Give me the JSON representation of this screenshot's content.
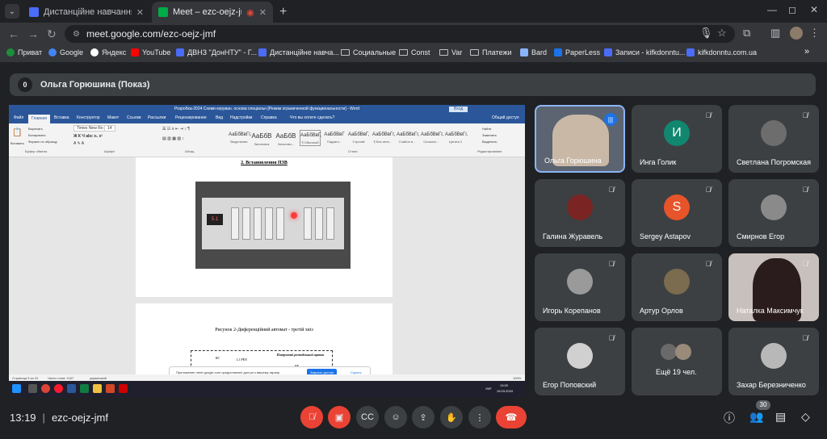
{
  "browser": {
    "tabs": [
      {
        "title": "Дистанційне навчання в ВСП ",
        "active": false
      },
      {
        "title": "Meet – ezc-oejz-jmf",
        "active": true
      }
    ],
    "new_tab": "+",
    "url": "meet.google.com/ezc-oejz-jmf",
    "window_controls": {
      "minimize": "—",
      "maximize": "◻",
      "close": "✕"
    }
  },
  "bookmarks": [
    {
      "label": "Приват",
      "color": "#1b8f3c",
      "icon": "privat-icon"
    },
    {
      "label": "Google",
      "color": "#4285f4",
      "icon": "google-icon"
    },
    {
      "label": "Яндекс",
      "color": "#ffffff",
      "icon": "yandex-icon"
    },
    {
      "label": "YouTube",
      "color": "#ff0000",
      "icon": "youtube-icon"
    },
    {
      "label": "ДВНЗ \"ДонНТУ\" - Г...",
      "color": "#4a6cf7",
      "icon": "site-icon"
    },
    {
      "label": "Дистанційне навча...",
      "color": "#4a6cf7",
      "icon": "site-icon"
    },
    {
      "label": "Социальные",
      "color": "",
      "icon": "folder-icon"
    },
    {
      "label": "Const",
      "color": "",
      "icon": "folder-icon"
    },
    {
      "label": "Var",
      "color": "",
      "icon": "folder-icon"
    },
    {
      "label": "Платежи",
      "color": "",
      "icon": "folder-icon"
    },
    {
      "label": "Bard",
      "color": "#8ab4f8",
      "icon": "bard-icon"
    },
    {
      "label": "PaperLess",
      "color": "#1a73e8",
      "icon": "paperless-icon"
    },
    {
      "label": "Записи - kifkdonntu...",
      "color": "#4a6cf7",
      "icon": "site-icon"
    },
    {
      "label": "kifkdonntu.com.ua",
      "color": "#4a6cf7",
      "icon": "site-icon"
    }
  ],
  "bookmarks_more": "»",
  "presenter": {
    "badge": "0",
    "label": "Ольга Горюшина (Показ)"
  },
  "shared_screen": {
    "window_title": "Розробка-2024 Схеми керуван. основа спеціальн [Режим ограниченной функциональности] - Word",
    "login_button": "Вход",
    "ribbon_tabs": [
      "Файл",
      "Главная",
      "Вставка",
      "Конструктор",
      "Макет",
      "Ссылки",
      "Рассылки",
      "Рецензирование",
      "Вид",
      "Надстройки",
      "Справка",
      "Что вы хотите сделать?"
    ],
    "share_label": "Общий доступ",
    "groups": [
      "Буфер обмена",
      "Шрифт",
      "Абзац",
      "Стили",
      "Редактирование"
    ],
    "font_name": "Times New Ro",
    "font_size": "14",
    "paste_label": "Вставить",
    "clipboard_items": [
      "Вырезать",
      "Копировать",
      "Формат по образцу"
    ],
    "editing_items": [
      "Найти",
      "Заменить",
      "Выделить"
    ],
    "styles": [
      {
        "sample": "АаБбВвГг,",
        "name": "Выделение"
      },
      {
        "sample": "АаБбВ",
        "name": "Заголовок"
      },
      {
        "sample": "АаБбВ",
        "name": "Заголово..."
      },
      {
        "sample": "АаБбВвГ,",
        "name": "¶ Обычный"
      },
      {
        "sample": "АаБбВвГ",
        "name": "Подзаго..."
      },
      {
        "sample": "АаБбВвГ,",
        "name": "Строгий"
      },
      {
        "sample": "АаБбВвГг,",
        "name": "¶ Без инте..."
      },
      {
        "sample": "АаБбВвГг,",
        "name": "Слабое в..."
      },
      {
        "sample": "АаБбВвГг,",
        "name": "Сильнох..."
      },
      {
        "sample": "АаБбВвГг,",
        "name": "Цитата 2"
      }
    ],
    "section_title": "2. Встановлення ПЗВ",
    "figure_caption": "Рисунок 2-Диференційний автомат - третій хвіз",
    "display_value": "5.1",
    "schematic": {
      "heading": "Поверховий розподільний щиток",
      "label_rc": "RC",
      "label_pen": "L1 PEN",
      "label_pe": "PE"
    },
    "status_left": "Страница 5 из 24",
    "status_words": "Число слов: 1167",
    "status_lang": "украинский",
    "status_zoom": "100%",
    "notification": "Приложение meet.google.com предоставлен доступ к вашему экрану.",
    "notification_button": "Закрыть доступ",
    "notification_link": "Скрыть",
    "taskbar_lang": "УКР",
    "taskbar_time": "13:20",
    "taskbar_date": "19.03.2024"
  },
  "participants": [
    {
      "name": "Ольга Горюшина",
      "type": "video",
      "speaking": true
    },
    {
      "name": "Инга Голик",
      "type": "initial",
      "initial": "И",
      "color": "#12876f"
    },
    {
      "name": "Светлана Погромская",
      "type": "photo",
      "color": "#6d6d6d"
    },
    {
      "name": "Галина Журавель",
      "type": "photo",
      "color": "#7a2424"
    },
    {
      "name": "Sergey Astapov",
      "type": "initial",
      "initial": "S",
      "color": "#e8542a"
    },
    {
      "name": "Смирнов Егор",
      "type": "photo",
      "color": "#8a8a8a"
    },
    {
      "name": "Игорь Корепанов",
      "type": "photo",
      "color": "#9a9a9a"
    },
    {
      "name": "Артур Орлов",
      "type": "photo",
      "color": "#7b6b4f"
    },
    {
      "name": "Наталка Максимчук",
      "type": "video",
      "color": "#3a2a2a"
    },
    {
      "name": "Егор Поповский",
      "type": "photo",
      "color": "#d0d0d0"
    },
    {
      "name": "Ещё 19 чел.",
      "type": "group",
      "color": "#6a6a6a"
    },
    {
      "name": "Захар Березниченко",
      "type": "photo",
      "color": "#b8b8b8"
    }
  ],
  "bottom_bar": {
    "time": "13:19",
    "meeting_code": "ezc-oejz-jmf",
    "participant_count": "30",
    "captions_label": "CC"
  },
  "colors": {
    "background": "#202124",
    "tile": "#3c4043",
    "danger": "#ea4335",
    "accent": "#8ab4f8"
  }
}
